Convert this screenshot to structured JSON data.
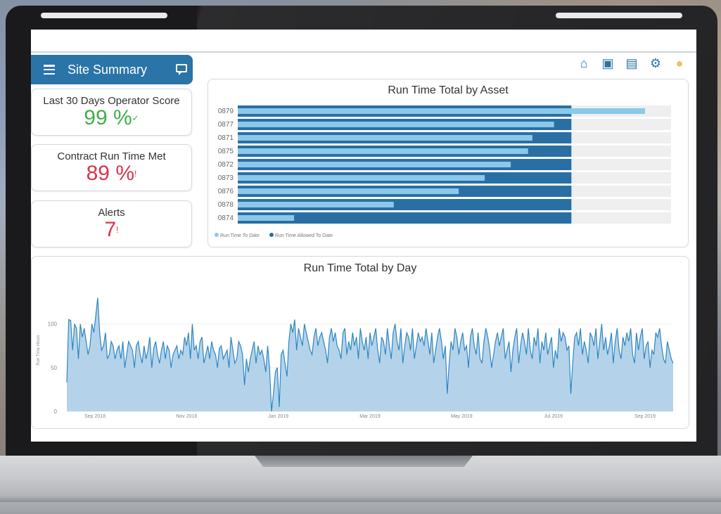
{
  "header": {
    "title": "Site Summary"
  },
  "toolbar": {
    "icons": [
      "home-icon",
      "report-icon",
      "clipboard-icon",
      "settings-icon",
      "lightbulb-icon"
    ]
  },
  "cards": [
    {
      "title": "Last 30 Days Operator Score",
      "value": "99 %",
      "indicator": "✓",
      "color": "#3fae49"
    },
    {
      "title": "Contract Run Time Met",
      "value": "89 %",
      "indicator": "!",
      "color": "#d9334f"
    },
    {
      "title": "Alerts",
      "value": "7",
      "indicator": "!",
      "color": "#d9334f"
    }
  ],
  "chart_data": [
    {
      "type": "bar",
      "title": "Run Time Total by Asset",
      "categories": [
        "0879",
        "0877",
        "0871",
        "0875",
        "0872",
        "0873",
        "0876",
        "0878",
        "0874"
      ],
      "series": [
        {
          "name": "Run Time To Date",
          "color": "#8cc8ea",
          "values": [
            0.94,
            0.73,
            0.68,
            0.67,
            0.63,
            0.57,
            0.51,
            0.36,
            0.13
          ]
        },
        {
          "name": "Run Time Allowed To Date",
          "color": "#2a6fa3",
          "values": [
            0.77,
            0.77,
            0.77,
            0.77,
            0.77,
            0.77,
            0.77,
            0.77,
            0.77
          ]
        }
      ]
    },
    {
      "type": "area",
      "title": "Run Time Total by Day",
      "ylabel": "Run Time Hours",
      "yticks": [
        0,
        50,
        100
      ],
      "ylim": [
        0,
        140
      ],
      "xticks": [
        "Sep 2018",
        "Nov 2018",
        "Jan 2019",
        "Mar 2019",
        "May 2019",
        "Jul 2019",
        "Sep 2019"
      ],
      "color": "#2e86c1",
      "fill": "#b4d3ea",
      "values": [
        33,
        105,
        104,
        70,
        100,
        95,
        60,
        100,
        85,
        95,
        80,
        65,
        75,
        100,
        90,
        110,
        130,
        90,
        70,
        75,
        90,
        60,
        65,
        80,
        75,
        60,
        70,
        75,
        60,
        80,
        50,
        65,
        80,
        75,
        70,
        50,
        75,
        80,
        65,
        55,
        75,
        60,
        70,
        85,
        50,
        72,
        80,
        65,
        55,
        70,
        80,
        60,
        75,
        70,
        50,
        65,
        70,
        75,
        60,
        70,
        65,
        85,
        75,
        90,
        60,
        100,
        70,
        75,
        60,
        80,
        85,
        55,
        65,
        75,
        60,
        80,
        70,
        65,
        50,
        72,
        75,
        60,
        65,
        70,
        50,
        85,
        70,
        55,
        60,
        80,
        75,
        65,
        30,
        60,
        45,
        60,
        70,
        80,
        55,
        75,
        65,
        70,
        60,
        45,
        75,
        50,
        0,
        20,
        45,
        50,
        5,
        65,
        70,
        55,
        40,
        80,
        100,
        90,
        105,
        70,
        95,
        85,
        75,
        100,
        90,
        80,
        70,
        65,
        85,
        95,
        75,
        85,
        90,
        80,
        70,
        55,
        85,
        95,
        80,
        90,
        75,
        70,
        60,
        90,
        95,
        65,
        80,
        70,
        90,
        75,
        85,
        60,
        95,
        80,
        70,
        85,
        60,
        90,
        75,
        85,
        95,
        70,
        55,
        85,
        80,
        65,
        95,
        75,
        60,
        90,
        100,
        80,
        70,
        95,
        55,
        75,
        90,
        85,
        70,
        95,
        60,
        75,
        90,
        80,
        85,
        75,
        95,
        80,
        65,
        90,
        55,
        70,
        85,
        95,
        80,
        60,
        75,
        20,
        55,
        80,
        70,
        95,
        85,
        65,
        80,
        90,
        70,
        75,
        50,
        85,
        95,
        75,
        65,
        90,
        60,
        55,
        80,
        95,
        85,
        70,
        50,
        65,
        80,
        90,
        75,
        85,
        95,
        60,
        70,
        80,
        45,
        70,
        85,
        95,
        55,
        75,
        90,
        80,
        65,
        95,
        70,
        60,
        85,
        75,
        95,
        55,
        80,
        70,
        90,
        65,
        75,
        85,
        50,
        70,
        60,
        95,
        80,
        90,
        85,
        70,
        75,
        20,
        55,
        85,
        90,
        75,
        95,
        65,
        80,
        70,
        55,
        90,
        85,
        75,
        95,
        60,
        80,
        100,
        70,
        85,
        65,
        75,
        90,
        55,
        80,
        95,
        70,
        60,
        85,
        75,
        90,
        80,
        95,
        65,
        55,
        90,
        70,
        85,
        95,
        60,
        75,
        80,
        50,
        70,
        65,
        90,
        85,
        95,
        75,
        60,
        55,
        80,
        70,
        60,
        55
      ]
    }
  ],
  "bar_legend": [
    "Run Time To Date",
    "Run Time Allowed To Date"
  ]
}
